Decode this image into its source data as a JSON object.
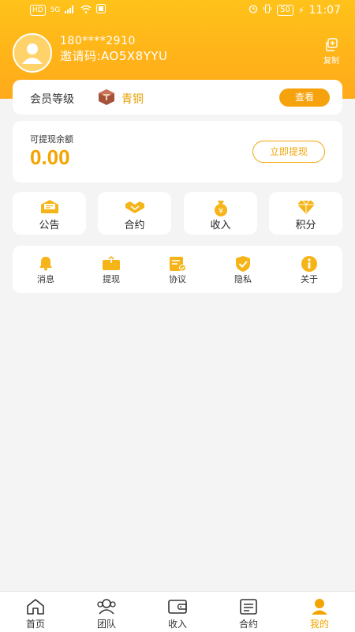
{
  "status_bar": {
    "left_badge": "HD",
    "network": "5G",
    "battery": "50",
    "time": "11:07"
  },
  "profile": {
    "phone": "180****2910",
    "invite": "邀请码:AO5X8YYU",
    "copy_label": "复制"
  },
  "member": {
    "label": "会员等级",
    "rank": "青铜",
    "view_button": "查看"
  },
  "balance": {
    "label": "可提现余额",
    "value": "0.00",
    "withdraw_button": "立即提现"
  },
  "quick_actions": [
    {
      "label": "公告",
      "icon": "announcement-icon"
    },
    {
      "label": "合约",
      "icon": "handshake-icon"
    },
    {
      "label": "收入",
      "icon": "money-bag-icon"
    },
    {
      "label": "积分",
      "icon": "diamond-icon"
    }
  ],
  "menu": [
    {
      "label": "消息",
      "icon": "bell-icon"
    },
    {
      "label": "提现",
      "icon": "withdraw-box-icon"
    },
    {
      "label": "协议",
      "icon": "agreement-icon"
    },
    {
      "label": "隐私",
      "icon": "shield-check-icon"
    },
    {
      "label": "关于",
      "icon": "info-icon"
    }
  ],
  "tabbar": [
    {
      "label": "首页",
      "icon": "home-icon"
    },
    {
      "label": "团队",
      "icon": "team-icon"
    },
    {
      "label": "收入",
      "icon": "wallet-icon"
    },
    {
      "label": "合约",
      "icon": "contract-icon"
    },
    {
      "label": "我的",
      "icon": "user-icon",
      "active": true
    }
  ],
  "colors": {
    "accent": "#f3a400",
    "header": "#ffb319",
    "icon": "#f5b417"
  }
}
